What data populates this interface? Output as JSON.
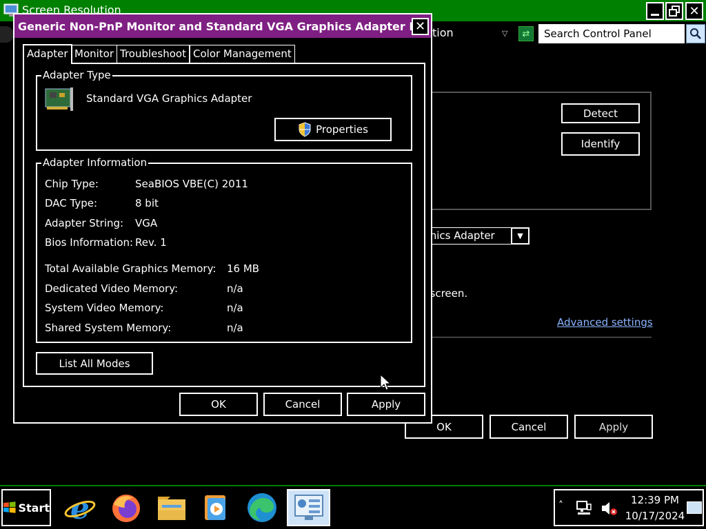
{
  "background_window": {
    "title": "Screen Resolution",
    "address_fragment": "tion",
    "search_placeholder": "Search Control Panel",
    "detect_label": "Detect",
    "identify_label": "Identify",
    "display_select_value": "aphics Adapter",
    "screen_text_fragment": "he screen.",
    "advanced_settings_label": "Advanced settings",
    "ok_label": "OK",
    "cancel_label": "Cancel",
    "apply_label": "Apply"
  },
  "dialog": {
    "title": "Generic Non-PnP Monitor and Standard VGA Graphics Adapter P...",
    "tabs": [
      {
        "label": "Adapter",
        "active": true
      },
      {
        "label": "Monitor",
        "active": false
      },
      {
        "label": "Troubleshoot",
        "active": false
      },
      {
        "label": "Color Management",
        "active": false
      }
    ],
    "adapter_type": {
      "group_label": "Adapter Type",
      "name": "Standard VGA Graphics Adapter",
      "properties_label": "Properties"
    },
    "adapter_info": {
      "group_label": "Adapter Information",
      "rows": [
        {
          "label": "Chip Type:",
          "value": "SeaBIOS VBE(C) 2011"
        },
        {
          "label": "DAC Type:",
          "value": "8 bit"
        },
        {
          "label": "Adapter String:",
          "value": "VGA"
        },
        {
          "label": "Bios Information:",
          "value": "Rev. 1"
        }
      ],
      "memory_rows": [
        {
          "label": "Total Available Graphics Memory:",
          "value": "16 MB"
        },
        {
          "label": "Dedicated Video Memory:",
          "value": "n/a"
        },
        {
          "label": "System Video Memory:",
          "value": "n/a"
        },
        {
          "label": "Shared System Memory:",
          "value": "n/a"
        }
      ]
    },
    "list_all_modes_label": "List All Modes",
    "ok_label": "OK",
    "cancel_label": "Cancel",
    "apply_label": "Apply"
  },
  "taskbar": {
    "start_label": "Start",
    "apps": [
      "internet-explorer-icon",
      "firefox-icon",
      "file-explorer-icon",
      "media-player-icon",
      "edge-icon",
      "control-panel-icon"
    ],
    "clock_time": "12:39 PM",
    "clock_date": "10/17/2024"
  },
  "colors": {
    "title_green": "#008000",
    "dialog_title_purple": "#7f1f83",
    "link_blue": "#8ab4ff"
  }
}
